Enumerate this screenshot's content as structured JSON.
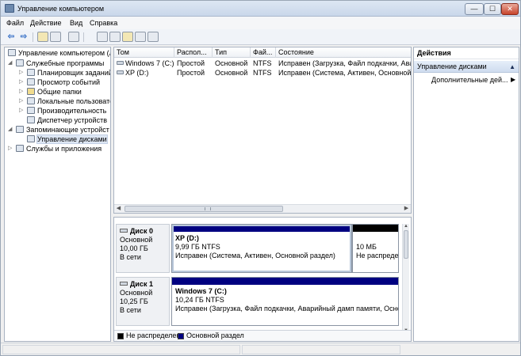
{
  "window": {
    "title": "Управление компьютером",
    "min_glyph": "—",
    "max_glyph": "☐",
    "close_glyph": "✕"
  },
  "menu": {
    "items": [
      "Файл",
      "Действие",
      "Вид",
      "Справка"
    ]
  },
  "toolbar": {
    "back_glyph": "⇦",
    "forward_glyph": "⇨"
  },
  "tree": {
    "root": "Управление компьютером (л",
    "system_tools": "Служебные программы",
    "task_scheduler": "Планировщик заданий",
    "event_viewer": "Просмотр событий",
    "shared_folders": "Общие папки",
    "local_users": "Локальные пользовате",
    "performance": "Производительность",
    "device_manager": "Диспетчер устройств",
    "storage": "Запоминающие устройст",
    "disk_management": "Управление дисками",
    "services": "Службы и приложения"
  },
  "volumes": {
    "columns": [
      "Том",
      "Распол...",
      "Тип",
      "Фай...",
      "Состояние"
    ],
    "rows": [
      {
        "name": "Windows 7 (C:)",
        "layout": "Простой",
        "type": "Основной",
        "fs": "NTFS",
        "status": "Исправен (Загрузка, Файл подкачки, Авари"
      },
      {
        "name": "XP (D:)",
        "layout": "Простой",
        "type": "Основной",
        "fs": "NTFS",
        "status": "Исправен (Система, Активен, Основной разд"
      }
    ]
  },
  "disks": [
    {
      "name": "Диск 0",
      "kind": "Основной",
      "size": "10,00 ГБ",
      "state": "В сети",
      "partitions": [
        {
          "name": "XP  (D:)",
          "size": "9,99 ГБ NTFS",
          "status": "Исправен (Система, Активен, Основной раздел)",
          "color": "#000080"
        },
        {
          "name": "",
          "size": "10 МБ",
          "status": "Не распреде",
          "color": "#000000"
        }
      ]
    },
    {
      "name": "Диск 1",
      "kind": "Основной",
      "size": "10,25 ГБ",
      "state": "В сети",
      "partitions": [
        {
          "name": "Windows 7  (C:)",
          "size": "10,24 ГБ NTFS",
          "status": "Исправен (Загрузка, Файл подкачки, Аварийный дамп памяти, Основнс",
          "color": "#000080"
        }
      ]
    }
  ],
  "legend": {
    "unallocated": "Не распределен",
    "primary": "Основной раздел",
    "unallocated_color": "#000000",
    "primary_color": "#000080"
  },
  "actions": {
    "header": "Действия",
    "section": "Управление дисками",
    "more": "Дополнительные дей...",
    "more_arrow": "▶",
    "collapse_glyph": "▲"
  }
}
